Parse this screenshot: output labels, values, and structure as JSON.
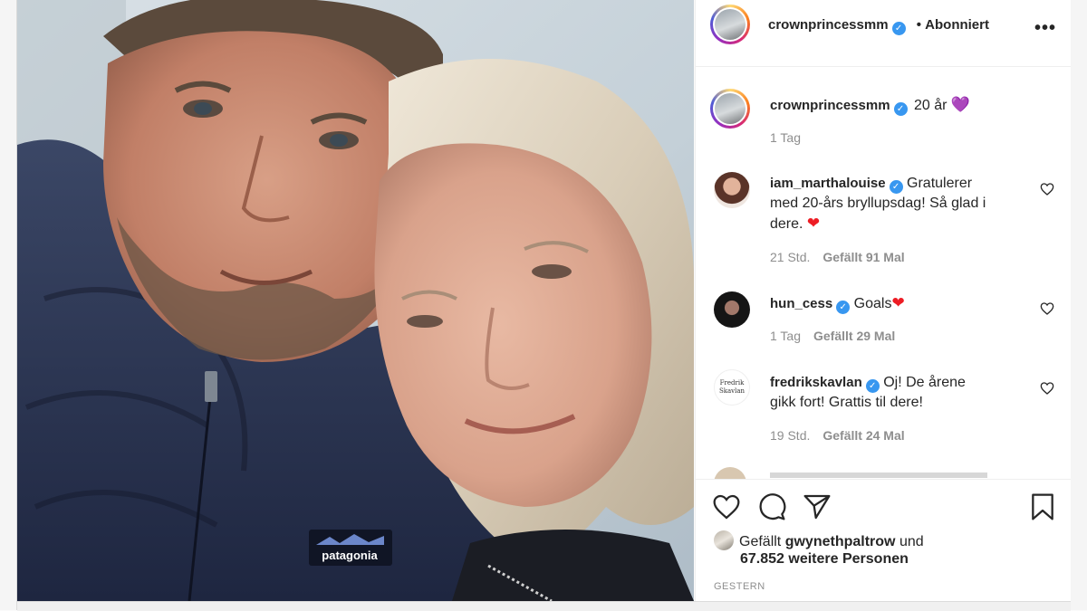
{
  "header": {
    "username": "crownprincessmm",
    "separator": "•",
    "follow_label": "Abonniert",
    "more_label": "•••"
  },
  "caption": {
    "username": "crownprincessmm",
    "text": "20 år",
    "emoji": "💜",
    "time": "1 Tag"
  },
  "comments": [
    {
      "username": "iam_marthalouise",
      "text_lines": [
        "Gratulerer",
        "med 20-års bryllupsdag! Så glad i",
        "dere."
      ],
      "emoji": "❤",
      "time": "21 Std.",
      "likes": "Gefällt 91 Mal"
    },
    {
      "username": "hun_cess",
      "text": "Goals",
      "emoji": "❤",
      "time": "1 Tag",
      "likes": "Gefällt 29 Mal"
    },
    {
      "username": "fredrikskavlan",
      "text_lines": [
        "Oj! De årene",
        "gikk fort! Grattis til dere!"
      ],
      "time": "19 Std.",
      "likes": "Gefällt 24 Mal",
      "avatar_text": [
        "Fredrik",
        "Skavlan"
      ]
    }
  ],
  "actions": {
    "icons": [
      "heart-icon",
      "comment-icon",
      "share-icon",
      "bookmark-icon"
    ]
  },
  "likes": {
    "prefix": "Gefällt",
    "user": "gwynethpaltrow",
    "conj": "und",
    "others": "67.852 weitere Personen"
  },
  "date": "GESTERN",
  "photo": {
    "jacket_logo": "patagonia"
  },
  "colors": {
    "verified": "#3897f0",
    "heart": "#ed1c24",
    "purple_heart": "#8e6cf0"
  }
}
